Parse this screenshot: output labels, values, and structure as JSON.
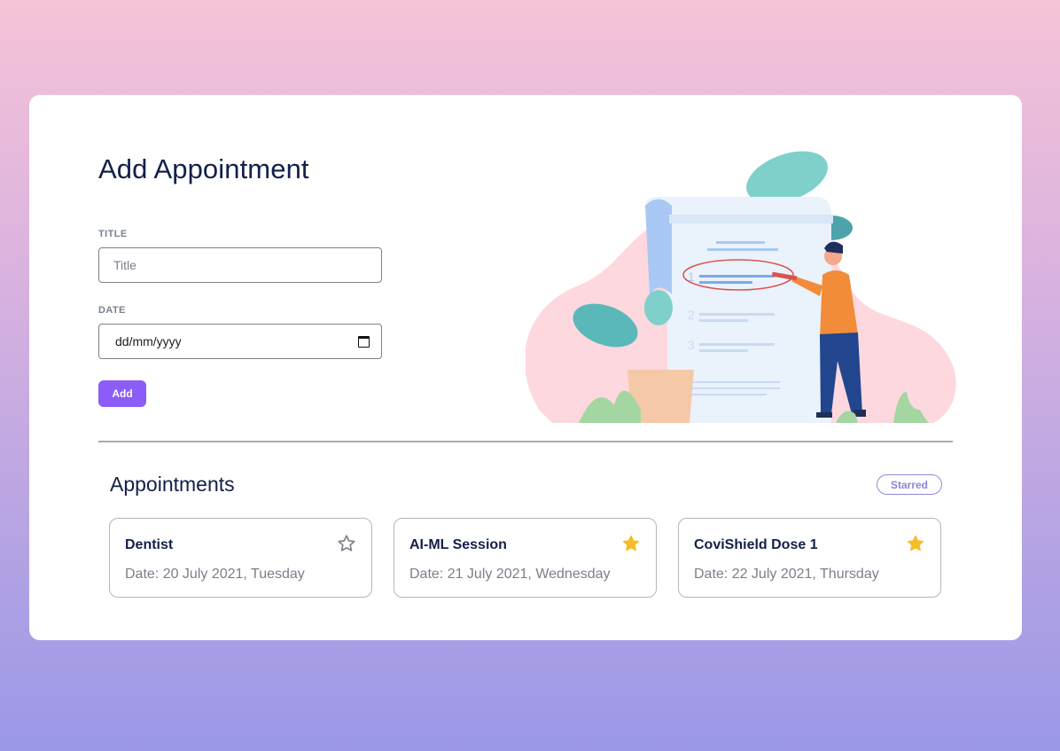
{
  "form": {
    "heading": "Add Appointment",
    "title_label": "TITLE",
    "title_placeholder": "Title",
    "date_label": "DATE",
    "date_placeholder": "dd/mm/yyyy",
    "add_label": "Add"
  },
  "list": {
    "heading": "Appointments",
    "starred_filter": "Starred",
    "items": [
      {
        "title": "Dentist",
        "date": "Date: 20 July 2021, Tuesday",
        "starred": false
      },
      {
        "title": "AI-ML Session",
        "date": "Date: 21 July 2021, Wednesday",
        "starred": true
      },
      {
        "title": "CoviShield Dose 1",
        "date": "Date: 22 July 2021, Thursday",
        "starred": true
      }
    ]
  },
  "colors": {
    "accent": "#8b5cf6",
    "star_filled": "#f6bd2a",
    "star_outline": "#7d8089",
    "heading": "#13204a"
  },
  "icons": {
    "calendar": "calendar-icon",
    "star": "star-icon"
  }
}
